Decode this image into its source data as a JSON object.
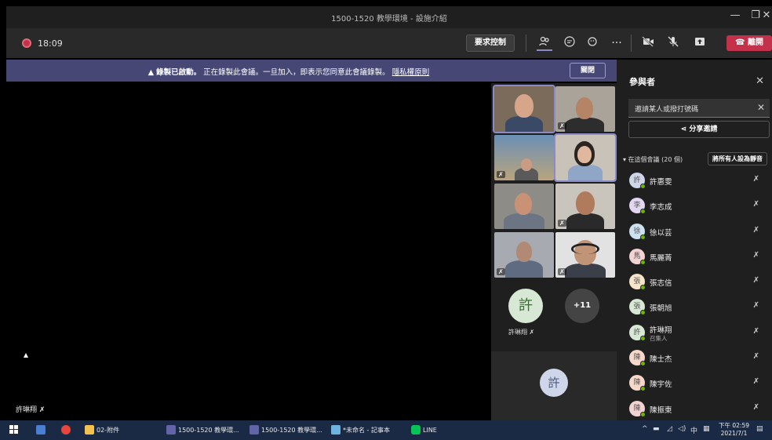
{
  "window": {
    "title": "1500-1520 教學環境 - 設施介紹",
    "minimize": "—",
    "maximize": "❐",
    "close": "✕"
  },
  "toolbar": {
    "timer": "18:09",
    "request_control": "要求控制",
    "leave": "離開",
    "icons": [
      "participants-icon",
      "chat-icon",
      "reactions-icon",
      "more-icon",
      "camera-off-icon",
      "mic-off-icon",
      "share-icon"
    ]
  },
  "banner": {
    "lead": "錄製已啟動。",
    "message": "正在錄製此會議。一旦加入，即表示您同意此會議錄製。",
    "link": "隱私權原則",
    "close": "關閉"
  },
  "stage": {
    "name": "許琳翔"
  },
  "grid": {
    "avatar_letter": "許",
    "avatar_name": "許琳翔",
    "more_count": "+11",
    "self_letter": "許"
  },
  "panel": {
    "title": "參與者",
    "invite_placeholder": "邀請某人或撥打號碼",
    "share_invite": "分享邀請",
    "section": "在這個會議 (20 個)",
    "mute_all": "將所有人設為靜音",
    "participants": [
      {
        "letter": "許",
        "name": "許惠雯",
        "role": "",
        "color": "#cfd6ea"
      },
      {
        "letter": "李",
        "name": "李志成",
        "role": "",
        "color": "#e3d6f1"
      },
      {
        "letter": "徐",
        "name": "徐以芸",
        "role": "",
        "color": "#cde2f0"
      },
      {
        "letter": "馬",
        "name": "馬麗菁",
        "role": "",
        "color": "#f3d2d2"
      },
      {
        "letter": "張",
        "name": "張志信",
        "role": "",
        "color": "#f6e5c8"
      },
      {
        "letter": "張",
        "name": "張朝旭",
        "role": "",
        "color": "#d7e8d4"
      },
      {
        "letter": "許",
        "name": "許琳翔",
        "role": "召集人",
        "color": "#d7e8d4"
      },
      {
        "letter": "陳",
        "name": "陳士杰",
        "role": "",
        "color": "#f6d7c8"
      },
      {
        "letter": "陳",
        "name": "陳宇佐",
        "role": "",
        "color": "#f6d7c8"
      },
      {
        "letter": "陳",
        "name": "陳振東",
        "role": "",
        "color": "#f3d2d2"
      }
    ]
  },
  "taskbar": {
    "items": [
      "02-附件",
      "1500-1520 教學環...",
      "1500-1520 教學環...",
      "*未命名 - 記事本",
      "LINE"
    ],
    "tray_lang": "中",
    "time": "下午 02:59",
    "date": "2021/7/1"
  },
  "colors": {
    "accent": "#8b8cc7",
    "banner": "#464775",
    "leave": "#c4314b",
    "taskbar": "#1b2a44"
  }
}
